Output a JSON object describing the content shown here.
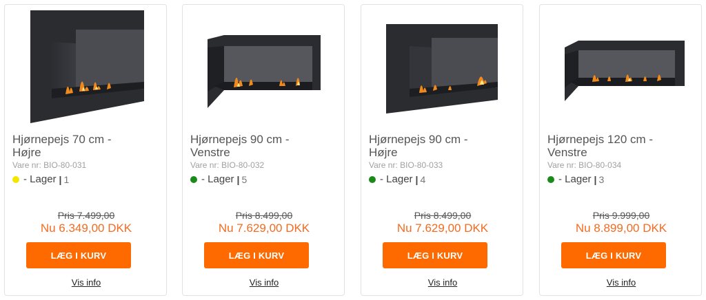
{
  "products": [
    {
      "image": "corner-fireplace-right-icon",
      "title_line1": "Hjørnepejs 70 cm -",
      "title_line2": "Højre",
      "sku": "Vare nr: BIO-80-031",
      "stock_color": "#f5e600",
      "stock_label": "- Lager",
      "stock_sep": "|",
      "stock_count": "1",
      "old_price": "Pris 7.499,00",
      "new_price": "Nu 6.349,00 DKK",
      "buy_label": "LÆG I KURV",
      "info_label": "Vis info"
    },
    {
      "image": "corner-fireplace-left-icon",
      "title_line1": "Hjørnepejs 90 cm -",
      "title_line2": "Venstre",
      "sku": "Vare nr: BIO-80-032",
      "stock_color": "#1a8a1a",
      "stock_label": "- Lager",
      "stock_sep": "|",
      "stock_count": "5",
      "old_price": "Pris 8.499,00",
      "new_price": "Nu 7.629,00 DKK",
      "buy_label": "LÆG I KURV",
      "info_label": "Vis info"
    },
    {
      "image": "corner-fireplace-right-icon",
      "title_line1": "Hjørnepejs 90 cm -",
      "title_line2": "Højre",
      "sku": "Vare nr: BIO-80-033",
      "stock_color": "#1a8a1a",
      "stock_label": "- Lager",
      "stock_sep": "|",
      "stock_count": "4",
      "old_price": "Pris 8.499,00",
      "new_price": "Nu 7.629,00 DKK",
      "buy_label": "LÆG I KURV",
      "info_label": "Vis info"
    },
    {
      "image": "corner-fireplace-left-icon",
      "title_line1": "Hjørnepejs 120 cm -",
      "title_line2": "Venstre",
      "sku": "Vare nr: BIO-80-034",
      "stock_color": "#1a8a1a",
      "stock_label": "- Lager",
      "stock_sep": "|",
      "stock_count": "3",
      "old_price": "Pris 9.999,00",
      "new_price": "Nu 8.899,00 DKK",
      "buy_label": "LÆG I KURV",
      "info_label": "Vis info"
    }
  ]
}
